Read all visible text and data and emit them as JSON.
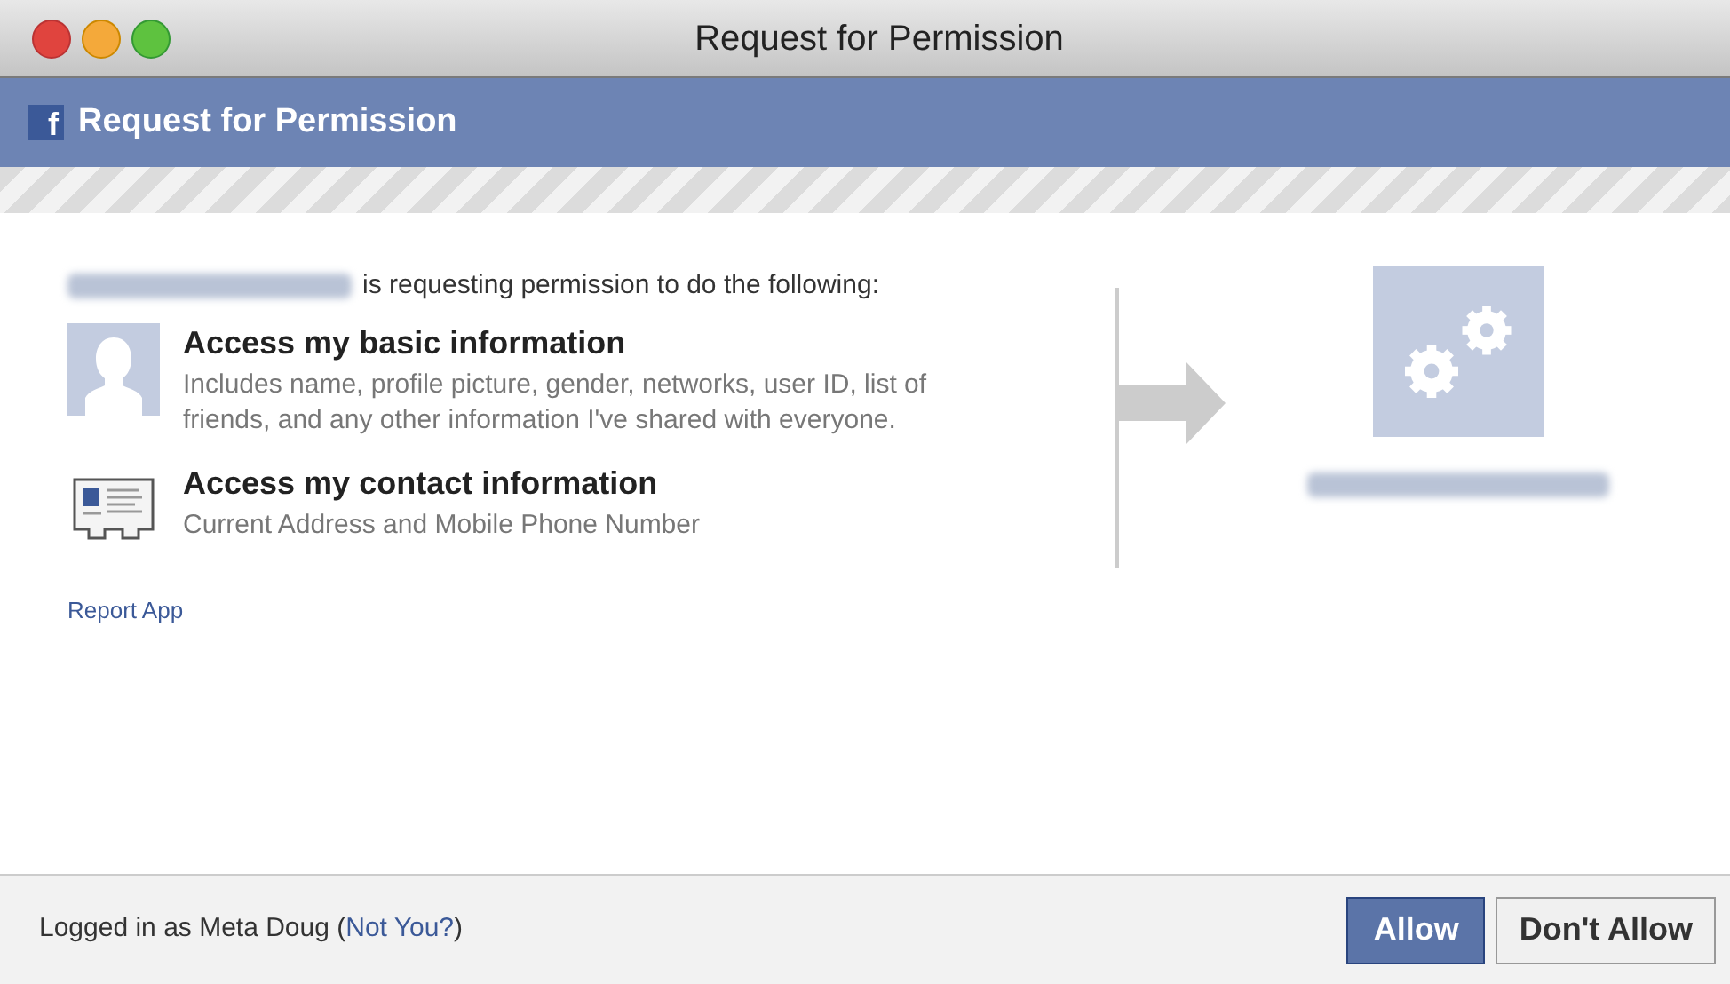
{
  "window": {
    "title": "Request for Permission"
  },
  "header": {
    "logo": "f",
    "title": "Request for Permission"
  },
  "intro": "is requesting permission to do the following:",
  "permissions": [
    {
      "kind": "profile",
      "title": "Access my basic information",
      "description": "Includes name, profile picture, gender, networks, user ID, list of friends, and any other information I've shared with everyone."
    },
    {
      "kind": "contact",
      "title": "Access my contact information",
      "description": "Current Address and Mobile Phone Number"
    }
  ],
  "report_link": "Report App",
  "footer": {
    "prefix": "Logged in as Meta Doug (",
    "link": "Not You?",
    "suffix": ")"
  },
  "buttons": [
    {
      "label": "Allow",
      "primary": true
    },
    {
      "label": "Don't Allow",
      "primary": false
    }
  ]
}
